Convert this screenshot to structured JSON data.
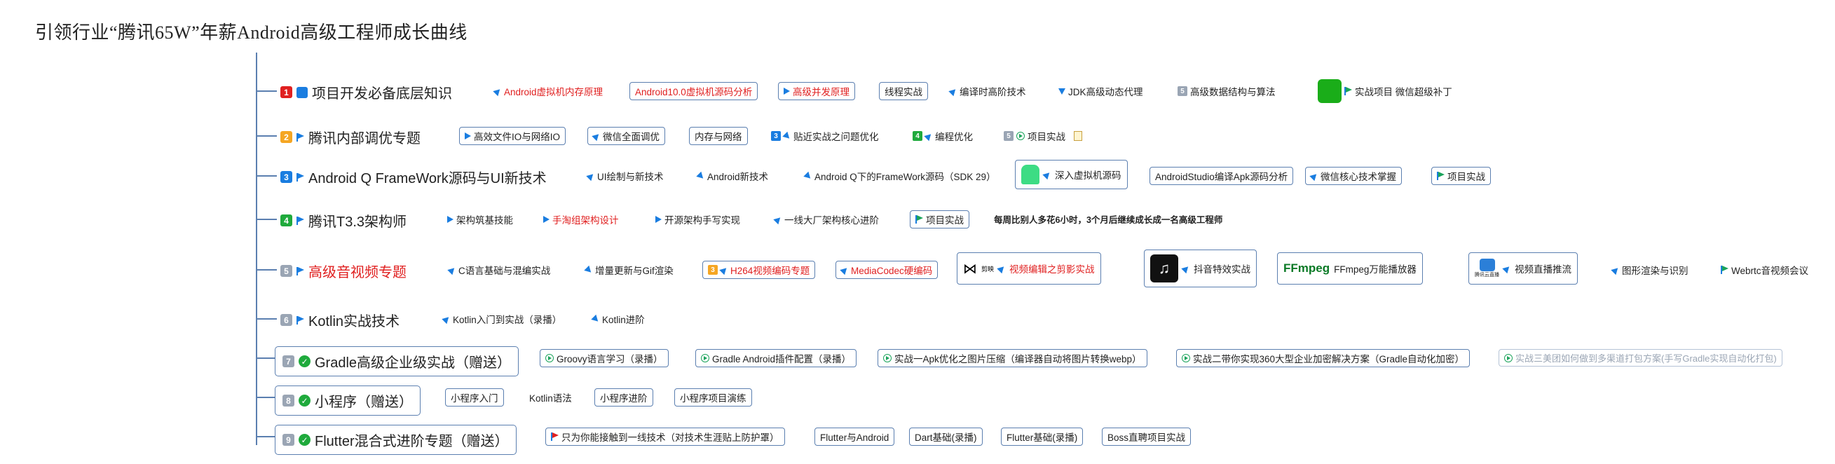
{
  "title": "引领行业“腾讯65W”年薪Android高级工程师成长曲线",
  "colors": {
    "line": "#5b7fb0",
    "red": "#e02020",
    "blue": "#1a7de0",
    "green": "#1faa3c",
    "orange": "#f5a623"
  },
  "sections": [
    {
      "num": "1",
      "title": "项目开发必备底层知识",
      "items": [
        "Android虚拟机内存原理",
        "Android10.0虚拟机源码分析",
        "高级并发原理",
        "线程实战",
        "编译时高阶技术",
        "JDK高级动态代理",
        "高级数据结构与算法",
        "实战项目 微信超级补丁"
      ]
    },
    {
      "num": "2",
      "title": "腾讯内部调优专题",
      "items": [
        "高效文件IO与网络IO",
        "微信全面调优",
        "内存与网络",
        "贴近实战之问题优化",
        "编程优化",
        "项目实战"
      ]
    },
    {
      "num": "3",
      "title": "Android Q FrameWork源码与UI新技术",
      "items": [
        "UI绘制与新技术",
        "Android新技术",
        "Android Q下的FrameWork源码（SDK 29）",
        "深入虚拟机源码",
        "AndroidStudio编译Apk源码分析",
        "微信核心技术掌握",
        "项目实战"
      ]
    },
    {
      "num": "4",
      "title": "腾讯T3.3架构师",
      "items": [
        "架构筑基技能",
        "手淘组架构设计",
        "开源架构手写实现",
        "一线大厂架构核心进阶",
        "项目实战",
        "每周比别人多花6小时，3个月后继续成长成一名高级工程师"
      ]
    },
    {
      "num": "5",
      "title": "高级音视频专题",
      "items": [
        "C语言基础与混编实战",
        "增量更新与Gif渲染",
        "H264视频编码专题",
        "MediaCodec硬编码",
        "视频编辑之剪影实战",
        "抖音特效实战",
        "FFmpeg万能播放器",
        "视频直播推流",
        "图形渲染与识别",
        "Webrtc音视频会议"
      ]
    },
    {
      "num": "6",
      "title": "Kotlin实战技术",
      "items": [
        "Kotlin入门到实战（录播）",
        "Kotlin进阶"
      ]
    },
    {
      "num": "7",
      "title": "Gradle高级企业级实战（赠送）",
      "items": [
        "Groovy语言学习（录播）",
        "Gradle Android插件配置（录播）",
        "实战一Apk优化之图片压缩（编译器自动将图片转换webp）",
        "实战二带你实现360大型企业加密解决方案（Gradle自动化加密）",
        "实战三美团如何做到多渠道打包方案(手写Gradle实现自动化打包)"
      ]
    },
    {
      "num": "8",
      "title": "小程序（赠送）",
      "items": [
        "小程序入门",
        "Kotlin语法",
        "小程序进阶",
        "小程序项目演练"
      ]
    },
    {
      "num": "9",
      "title": "Flutter混合式进阶专题（赠送）",
      "items": [
        "只为你能接触到一线技术（对技术生涯贴上防护罩）",
        "Flutter与Android",
        "Dart基础(录播)",
        "Flutter基础(录播)",
        "Boss直聘项目实战"
      ]
    }
  ],
  "logos": {
    "capcut": "剪映",
    "ffmpeg": "FFmpeg",
    "tencent": "腾讯云直播"
  }
}
